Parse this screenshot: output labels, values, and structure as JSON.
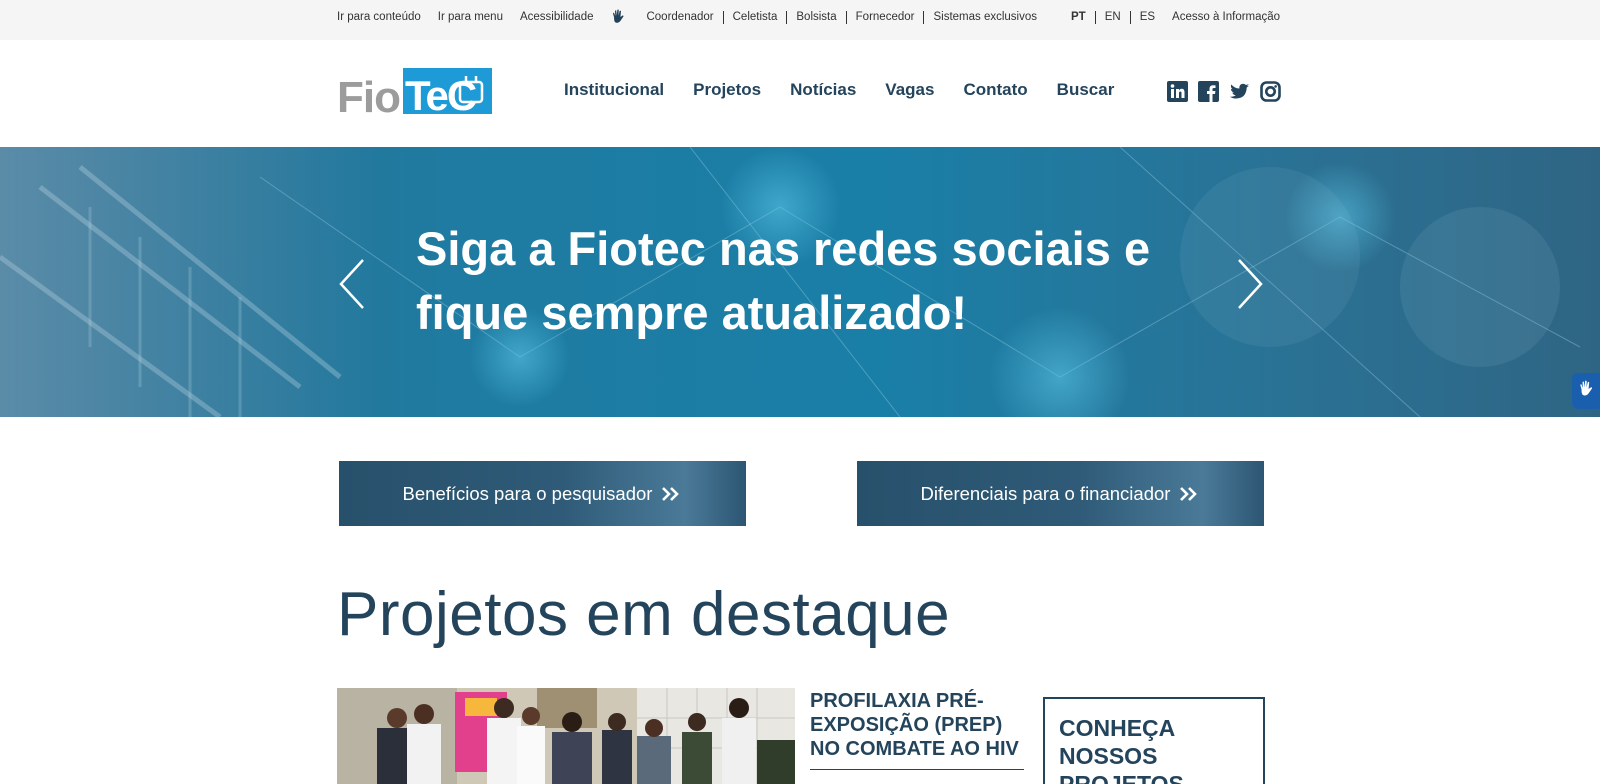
{
  "topbar": {
    "skip_content": "Ir para conteúdo",
    "skip_menu": "Ir para menu",
    "accessibility": "Acessibilidade",
    "hand_icon": "sign-language-icon",
    "profiles": [
      "Coordenador",
      "Celetista",
      "Bolsista",
      "Fornecedor",
      "Sistemas exclusivos"
    ],
    "languages": [
      "PT",
      "EN",
      "ES"
    ],
    "access_info": "Acesso à Informação"
  },
  "header": {
    "logo_text": "FioTeC",
    "nav": [
      "Institucional",
      "Projetos",
      "Notícias",
      "Vagas",
      "Contato",
      "Buscar"
    ],
    "social_icons": [
      "linkedin-icon",
      "facebook-icon",
      "twitter-icon",
      "instagram-icon"
    ]
  },
  "hero": {
    "line1": "Siga a Fiotec nas redes sociais e",
    "line2": "fique sempre atualizado!",
    "prev_icon": "chevron-left-icon",
    "next_icon": "chevron-right-icon"
  },
  "cta": {
    "researcher": "Benefícios para o pesquisador",
    "funder": "Diferenciais para o financiador",
    "chevron_icon": "double-chevron-right-icon"
  },
  "featured": {
    "title": "Projetos em destaque",
    "project_title": "PROFILAXIA PRÉ-EXPOSIÇÃO (PREP) NO COMBATE AO HIV",
    "know_more": "CONHEÇA NOSSOS PROJETOS"
  },
  "colors": {
    "primary": "#24445c",
    "hero_blue": "#1a7fa7",
    "logo_blue": "#1e9ad6",
    "logo_gray": "#9c9c9c",
    "topbar_bg": "#f5f5f5"
  }
}
